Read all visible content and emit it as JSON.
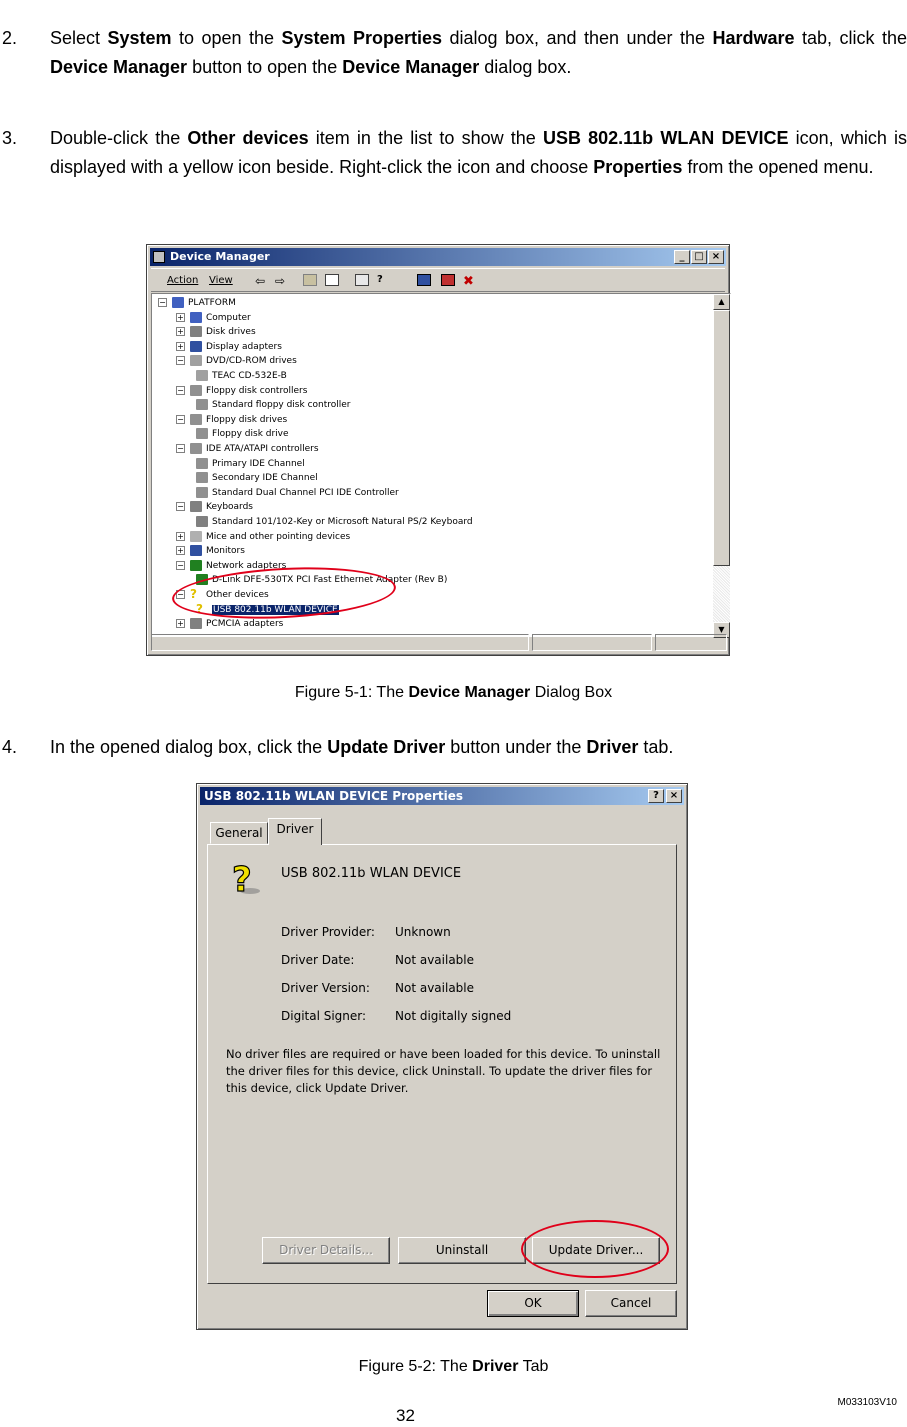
{
  "steps": [
    {
      "number": "2.",
      "parts": [
        {
          "t": "Select "
        },
        {
          "b": "System"
        },
        {
          "t": " to open the "
        },
        {
          "b": "System Properties"
        },
        {
          "t": " dialog box, and then under the "
        },
        {
          "b": "Hardware"
        },
        {
          "t": " tab, click the "
        },
        {
          "b": "Device Manager"
        },
        {
          "t": " button to open the "
        },
        {
          "b": "Device Manager"
        },
        {
          "t": " dialog box."
        }
      ]
    },
    {
      "number": "3.",
      "parts": [
        {
          "t": "Double-click the "
        },
        {
          "b": "Other devices"
        },
        {
          "t": " item in the list to show the "
        },
        {
          "b": "USB 802.11b WLAN DEVICE"
        },
        {
          "t": " icon, which is displayed with a yellow icon beside. Right-click the icon and choose "
        },
        {
          "b": "Properties"
        },
        {
          "t": " from the opened menu."
        }
      ]
    },
    {
      "number": "4.",
      "parts": [
        {
          "t": "In the opened dialog box, click the "
        },
        {
          "b": "Update Driver"
        },
        {
          "t": " button under the "
        },
        {
          "b": "Driver"
        },
        {
          "t": " tab."
        }
      ]
    }
  ],
  "figure1": {
    "caption_prefix": "Figure 5-1: The ",
    "caption_bold": "Device Manager",
    "caption_suffix": " Dialog Box",
    "window_title": "Device Manager",
    "menu": [
      "Action",
      "View"
    ],
    "tree": [
      {
        "level": 0,
        "exp": "−",
        "label": "PLATFORM",
        "icon": "computer-icon",
        "color": "#4060c0"
      },
      {
        "level": 1,
        "exp": "+",
        "label": "Computer",
        "icon": "computer-icon",
        "color": "#4060c0"
      },
      {
        "level": 1,
        "exp": "+",
        "label": "Disk drives",
        "icon": "disk-icon",
        "color": "#808080"
      },
      {
        "level": 1,
        "exp": "+",
        "label": "Display adapters",
        "icon": "display-icon",
        "color": "#3050a0"
      },
      {
        "level": 1,
        "exp": "−",
        "label": "DVD/CD-ROM drives",
        "icon": "cdrom-icon",
        "color": "#a0a0a0"
      },
      {
        "level": 2,
        "exp": "",
        "label": "TEAC CD-532E-B",
        "icon": "cdrom-icon",
        "color": "#a0a0a0"
      },
      {
        "level": 1,
        "exp": "−",
        "label": "Floppy disk controllers",
        "icon": "controller-icon",
        "color": "#909090"
      },
      {
        "level": 2,
        "exp": "",
        "label": "Standard floppy disk controller",
        "icon": "controller-icon",
        "color": "#909090"
      },
      {
        "level": 1,
        "exp": "−",
        "label": "Floppy disk drives",
        "icon": "floppy-icon",
        "color": "#909090"
      },
      {
        "level": 2,
        "exp": "",
        "label": "Floppy disk drive",
        "icon": "floppy-icon",
        "color": "#909090"
      },
      {
        "level": 1,
        "exp": "−",
        "label": "IDE ATA/ATAPI controllers",
        "icon": "controller-icon",
        "color": "#909090"
      },
      {
        "level": 2,
        "exp": "",
        "label": "Primary IDE Channel",
        "icon": "controller-icon",
        "color": "#909090"
      },
      {
        "level": 2,
        "exp": "",
        "label": "Secondary IDE Channel",
        "icon": "controller-icon",
        "color": "#909090"
      },
      {
        "level": 2,
        "exp": "",
        "label": "Standard Dual Channel PCI IDE Controller",
        "icon": "controller-icon",
        "color": "#909090"
      },
      {
        "level": 1,
        "exp": "−",
        "label": "Keyboards",
        "icon": "keyboard-icon",
        "color": "#808080"
      },
      {
        "level": 2,
        "exp": "",
        "label": "Standard 101/102-Key or Microsoft Natural PS/2 Keyboard",
        "icon": "keyboard-icon",
        "color": "#808080"
      },
      {
        "level": 1,
        "exp": "+",
        "label": "Mice and other pointing devices",
        "icon": "mouse-icon",
        "color": "#b0b0b0"
      },
      {
        "level": 1,
        "exp": "+",
        "label": "Monitors",
        "icon": "monitor-icon",
        "color": "#3050a0"
      },
      {
        "level": 1,
        "exp": "−",
        "label": "Network adapters",
        "icon": "network-icon",
        "color": "#208020"
      },
      {
        "level": 2,
        "exp": "",
        "label": "D-Link DFE-530TX PCI Fast Ethernet Adapter (Rev B)",
        "icon": "network-icon",
        "color": "#208020"
      },
      {
        "level": 1,
        "exp": "−",
        "label": "Other devices",
        "icon": "question-icon",
        "color": "#e0c000"
      },
      {
        "level": 2,
        "exp": "",
        "label": "USB 802.11b WLAN DEVICE",
        "icon": "question-icon",
        "color": "#e0c000",
        "selected": true
      },
      {
        "level": 1,
        "exp": "+",
        "label": "PCMCIA adapters",
        "icon": "pcmcia-icon",
        "color": "#808080"
      }
    ]
  },
  "figure2": {
    "caption_prefix": "Figure 5-2: The ",
    "caption_bold": "Driver",
    "caption_suffix": " Tab",
    "window_title": "USB 802.11b WLAN DEVICE Properties",
    "tabs": [
      "General",
      "Driver"
    ],
    "device_name": "USB 802.11b WLAN DEVICE",
    "fields": [
      {
        "label": "Driver Provider:",
        "value": "Unknown"
      },
      {
        "label": "Driver Date:",
        "value": "Not available"
      },
      {
        "label": "Driver Version:",
        "value": "Not available"
      },
      {
        "label": "Digital Signer:",
        "value": "Not digitally signed"
      }
    ],
    "message_lines": [
      "No driver files are required or have been loaded for this device. To uninstall",
      "the driver files for this device, click Uninstall. To update the driver files for",
      "this device, click Update Driver."
    ],
    "buttons": {
      "driver_details": "Driver Details...",
      "uninstall": "Uninstall",
      "update_driver": "Update Driver...",
      "ok": "OK",
      "cancel": "Cancel"
    }
  },
  "footer": {
    "doc_code": "M033103V10",
    "page_number": "32"
  }
}
